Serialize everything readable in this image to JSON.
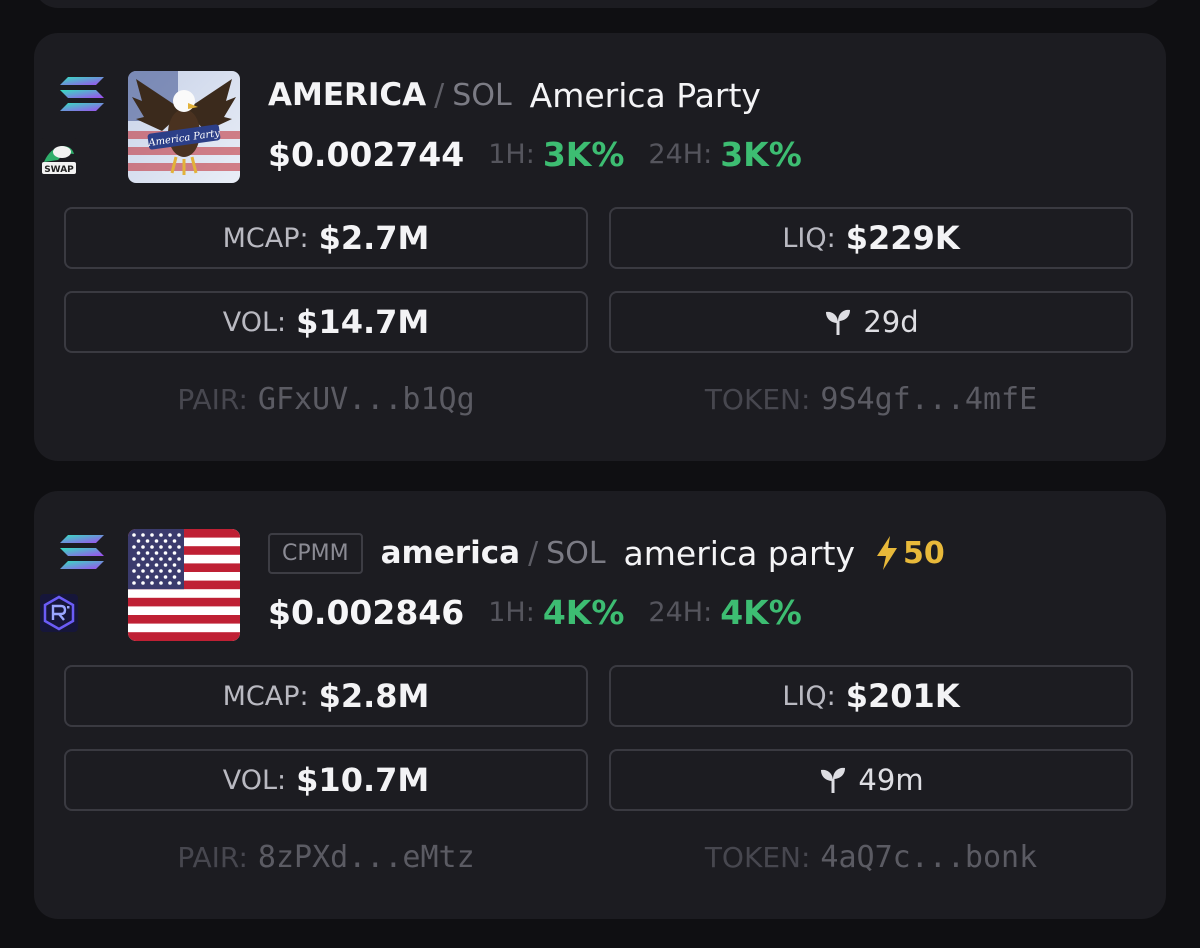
{
  "cards": [
    {
      "symbol": "AMERICA",
      "quote": "SOL",
      "name": "America Party",
      "price": "$0.002744",
      "h1_label": "1H:",
      "h1_change": "3K%",
      "h24_label": "24H:",
      "h24_change": "3K%",
      "dex_icon": "swap-icon",
      "dex_label": "SWAP",
      "avatar": "eagle-america-party-logo",
      "avatar_text": "America Party",
      "mcap_label": "MCAP:",
      "mcap": "$2.7M",
      "liq_label": "LIQ:",
      "liq": "$229K",
      "vol_label": "VOL:",
      "vol": "$14.7M",
      "age": "29d",
      "pair_label": "PAIR:",
      "pair": "GFxUV...b1Qg",
      "token_label": "TOKEN:",
      "token": "9S4gf...4mfE"
    },
    {
      "badge": "CPMM",
      "symbol": "america",
      "quote": "SOL",
      "name": "america party",
      "boost": "50",
      "price": "$0.002846",
      "h1_label": "1H:",
      "h1_change": "4K%",
      "h24_label": "24H:",
      "h24_change": "4K%",
      "dex_icon": "raydium-icon",
      "avatar": "us-flag-image",
      "mcap_label": "MCAP:",
      "mcap": "$2.8M",
      "liq_label": "LIQ:",
      "liq": "$201K",
      "vol_label": "VOL:",
      "vol": "$10.7M",
      "age": "49m",
      "pair_label": "PAIR:",
      "pair": "8zPXd...eMtz",
      "token_label": "TOKEN:",
      "token": "4aQ7c...bonk"
    }
  ],
  "colors": {
    "background": "#0f0f12",
    "card": "#1c1c21",
    "positive": "#3dbd72",
    "boost": "#e8b93a",
    "border": "#3a3a41"
  }
}
